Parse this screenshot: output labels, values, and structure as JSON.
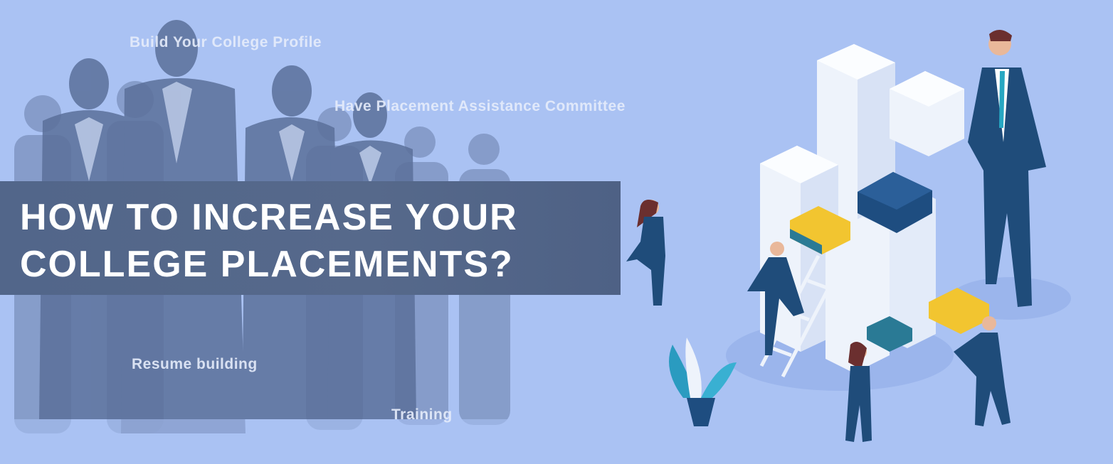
{
  "banner": {
    "title_line1": "HOW TO INCREASE YOUR",
    "title_line2": "COLLEGE PLACEMENTS?",
    "captions": [
      "Build Your College Profile",
      "Have Placement Assistance Committee",
      "Resume building",
      "Training"
    ]
  },
  "colors": {
    "background": "#aac2f3",
    "title_box": "#56698a",
    "silhouette": "#5b709a",
    "suit": "#1f4c7a",
    "paper": "#eef3fb",
    "folder_yellow": "#f2c530"
  }
}
